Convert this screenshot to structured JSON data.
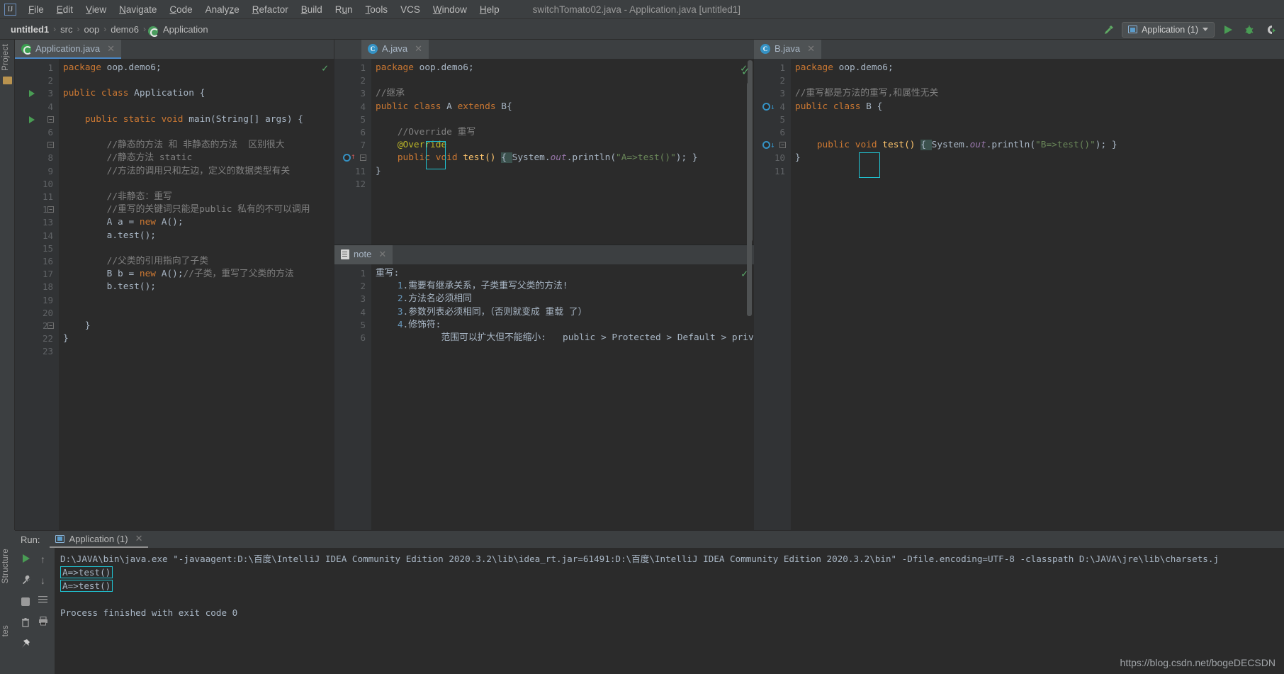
{
  "window": {
    "title": "switchTomato02.java - Application.java [untitled1]",
    "logo_icon": "intellij-idea-logo"
  },
  "menubar": {
    "items": [
      {
        "label": "File",
        "mnemonic": "F"
      },
      {
        "label": "Edit",
        "mnemonic": "E"
      },
      {
        "label": "View",
        "mnemonic": "V"
      },
      {
        "label": "Navigate",
        "mnemonic": "N"
      },
      {
        "label": "Code",
        "mnemonic": "C"
      },
      {
        "label": "Analyze",
        "mnemonic": "z"
      },
      {
        "label": "Refactor",
        "mnemonic": "R"
      },
      {
        "label": "Build",
        "mnemonic": "B"
      },
      {
        "label": "Run",
        "mnemonic": "u"
      },
      {
        "label": "Tools",
        "mnemonic": "T"
      },
      {
        "label": "VCS",
        "mnemonic": ""
      },
      {
        "label": "Window",
        "mnemonic": "W"
      },
      {
        "label": "Help",
        "mnemonic": "H"
      }
    ]
  },
  "breadcrumb": {
    "items": [
      "untitled1",
      "src",
      "oop",
      "demo6",
      "Application"
    ],
    "separator": "›",
    "last_icon": "java-class-icon"
  },
  "toolbar": {
    "build_icon": "hammer-icon",
    "run_config_label": "Application (1)",
    "run_config_icon": "run-configuration-icon",
    "dropdown_icon": "chevron-down-icon",
    "run_icon": "run-triangle-icon",
    "debug_icon": "debug-bug-icon",
    "run_with_coverage_icon": "run-coverage-icon"
  },
  "rails": {
    "left_top": "Project",
    "left_bottom": "Structure",
    "left_bottom2": "tes"
  },
  "editors": {
    "left": {
      "tab": {
        "label": "Application.java",
        "icon": "java-runnable-class-icon",
        "close_icon": "close-icon",
        "active": true
      },
      "inspection_status": "ok",
      "lines": [
        {
          "n": 1,
          "tokens": [
            {
              "t": "package ",
              "c": "kw"
            },
            {
              "t": "oop.demo6;",
              "c": "txt"
            }
          ]
        },
        {
          "n": 2,
          "tokens": []
        },
        {
          "n": 3,
          "tokens": [
            {
              "t": "public class ",
              "c": "kw"
            },
            {
              "t": "Application {",
              "c": "txt"
            }
          ],
          "gutter": "run-triangle"
        },
        {
          "n": 4,
          "tokens": []
        },
        {
          "n": 5,
          "tokens": [
            {
              "t": "    public static void ",
              "c": "kw"
            },
            {
              "t": "main(String[] args) {",
              "c": "txt"
            }
          ],
          "gutter": "run-triangle",
          "fold": true
        },
        {
          "n": 6,
          "tokens": []
        },
        {
          "n": 7,
          "tokens": [
            {
              "t": "        //静态的方法 和 非静态的方法  区别很大",
              "c": "cmt"
            }
          ],
          "fold": true
        },
        {
          "n": 8,
          "tokens": [
            {
              "t": "        //静态方法 static",
              "c": "cmt"
            }
          ]
        },
        {
          "n": 9,
          "tokens": [
            {
              "t": "        //方法的调用只和左边，定义的数据类型有关",
              "c": "cmt"
            }
          ]
        },
        {
          "n": 10,
          "tokens": []
        },
        {
          "n": 11,
          "tokens": [
            {
              "t": "        //非静态：重写",
              "c": "cmt"
            }
          ]
        },
        {
          "n": 12,
          "tokens": [
            {
              "t": "        //重写的关键词只能是public 私有的不可以调用",
              "c": "cmt"
            }
          ],
          "fold": true
        },
        {
          "n": 13,
          "tokens": [
            {
              "t": "        A a = ",
              "c": "txt"
            },
            {
              "t": "new ",
              "c": "kw"
            },
            {
              "t": "A();",
              "c": "txt"
            }
          ]
        },
        {
          "n": 14,
          "tokens": [
            {
              "t": "        a.test();",
              "c": "txt"
            }
          ]
        },
        {
          "n": 15,
          "tokens": []
        },
        {
          "n": 16,
          "tokens": [
            {
              "t": "        //父类的引用指向了子类",
              "c": "cmt"
            }
          ]
        },
        {
          "n": 17,
          "tokens": [
            {
              "t": "        B b = ",
              "c": "txt"
            },
            {
              "t": "new ",
              "c": "kw"
            },
            {
              "t": "A();",
              "c": "txt"
            },
            {
              "t": "//子类，重写了父类的方法",
              "c": "cmt"
            }
          ]
        },
        {
          "n": 18,
          "tokens": [
            {
              "t": "        b.test();",
              "c": "txt"
            }
          ]
        },
        {
          "n": 19,
          "tokens": []
        },
        {
          "n": 20,
          "tokens": []
        },
        {
          "n": 21,
          "tokens": [
            {
              "t": "    }",
              "c": "txt"
            }
          ],
          "fold": true
        },
        {
          "n": 22,
          "tokens": [
            {
              "t": "}",
              "c": "txt"
            }
          ]
        },
        {
          "n": 23,
          "tokens": []
        }
      ]
    },
    "middle": {
      "tab": {
        "label": "A.java",
        "icon": "java-class-icon",
        "close_icon": "close-icon"
      },
      "inspection_status": "ok",
      "lines": [
        {
          "n": 1,
          "tokens": [
            {
              "t": "package ",
              "c": "kw"
            },
            {
              "t": "oop.demo6;",
              "c": "txt"
            }
          ]
        },
        {
          "n": 2,
          "tokens": []
        },
        {
          "n": 3,
          "tokens": [
            {
              "t": "//继承",
              "c": "cmt"
            }
          ]
        },
        {
          "n": 4,
          "tokens": [
            {
              "t": "public class ",
              "c": "kw"
            },
            {
              "t": "A ",
              "c": "txt"
            },
            {
              "t": "extends ",
              "c": "kw"
            },
            {
              "t": "B{",
              "c": "txt"
            }
          ]
        },
        {
          "n": 5,
          "tokens": []
        },
        {
          "n": 6,
          "tokens": [
            {
              "t": "    //Override 重写",
              "c": "cmt"
            }
          ]
        },
        {
          "n": 7,
          "tokens": [
            {
              "t": "    @Override",
              "c": "anno"
            }
          ]
        },
        {
          "n": 8,
          "tokens": [
            {
              "t": "    public void ",
              "c": "kw"
            },
            {
              "t": "test() ",
              "c": "meth"
            },
            {
              "t": "{ ",
              "c": "brace"
            },
            {
              "t": "System.",
              "c": "txt"
            },
            {
              "t": "out",
              "c": "fld"
            },
            {
              "t": ".println(",
              "c": "txt"
            },
            {
              "t": "\"A=>test()\"",
              "c": "str"
            },
            {
              "t": "); }",
              "c": "txt"
            }
          ],
          "gutter": "override-impl",
          "fold": true
        },
        {
          "n": 11,
          "tokens": [
            {
              "t": "}",
              "c": "txt"
            }
          ]
        },
        {
          "n": 12,
          "tokens": []
        }
      ],
      "cursor_box": "text-cursor-highlight"
    },
    "right": {
      "tab": {
        "label": "B.java",
        "icon": "java-class-icon",
        "close_icon": "close-icon"
      },
      "inspection_status": "ok",
      "lines": [
        {
          "n": 1,
          "tokens": [
            {
              "t": "package ",
              "c": "kw"
            },
            {
              "t": "oop.demo6;",
              "c": "txt"
            }
          ]
        },
        {
          "n": 2,
          "tokens": []
        },
        {
          "n": 3,
          "tokens": [
            {
              "t": "//重写都是方法的重写,和属性无关",
              "c": "cmt"
            }
          ]
        },
        {
          "n": 4,
          "tokens": [
            {
              "t": "public class ",
              "c": "kw"
            },
            {
              "t": "B {",
              "c": "txt"
            }
          ],
          "gutter": "overridden-marker"
        },
        {
          "n": 5,
          "tokens": []
        },
        {
          "n": 6,
          "tokens": []
        },
        {
          "n": 7,
          "tokens": [
            {
              "t": "    public void ",
              "c": "kw"
            },
            {
              "t": "test() ",
              "c": "meth"
            },
            {
              "t": "{ ",
              "c": "brace"
            },
            {
              "t": "System.",
              "c": "txt"
            },
            {
              "t": "out",
              "c": "fld"
            },
            {
              "t": ".println(",
              "c": "txt"
            },
            {
              "t": "\"B=>test()\"",
              "c": "str"
            },
            {
              "t": "); }",
              "c": "txt"
            }
          ],
          "gutter": "overridden-marker",
          "fold": true
        },
        {
          "n": 10,
          "tokens": [
            {
              "t": "}",
              "c": "txt"
            }
          ]
        },
        {
          "n": 11,
          "tokens": []
        }
      ],
      "cursor_box": "text-cursor-highlight"
    }
  },
  "note_panel": {
    "tab": {
      "label": "note",
      "icon": "text-file-icon",
      "close_icon": "close-icon"
    },
    "inspection_status": "ok",
    "lines": [
      {
        "n": 1,
        "tokens": [
          {
            "t": "重写:",
            "c": "txt"
          }
        ]
      },
      {
        "n": 2,
        "tokens": [
          {
            "t": "    ",
            "c": "txt"
          },
          {
            "t": "1",
            "c": "num"
          },
          {
            "t": ".需要有继承关系，子类重写父类的方法!",
            "c": "txt"
          }
        ]
      },
      {
        "n": 3,
        "tokens": [
          {
            "t": "    ",
            "c": "txt"
          },
          {
            "t": "2",
            "c": "num"
          },
          {
            "t": ".方法名必须相同",
            "c": "txt"
          }
        ]
      },
      {
        "n": 4,
        "tokens": [
          {
            "t": "    ",
            "c": "txt"
          },
          {
            "t": "3",
            "c": "num"
          },
          {
            "t": ".参数列表必须相同，（否则就变成 重载 了）",
            "c": "txt"
          }
        ]
      },
      {
        "n": 5,
        "tokens": [
          {
            "t": "    ",
            "c": "txt"
          },
          {
            "t": "4",
            "c": "num"
          },
          {
            "t": ".修饰符:",
            "c": "txt"
          }
        ]
      },
      {
        "n": 6,
        "tokens": [
          {
            "t": "            范围可以扩大但不能缩小:   public > Protected > Default > private",
            "c": "txt"
          }
        ]
      }
    ]
  },
  "run_panel": {
    "label": "Run:",
    "tab": {
      "label": "Application (1)",
      "icon": "run-configuration-icon",
      "close_icon": "close-icon"
    },
    "side_tools": [
      {
        "name": "rerun-icon",
        "glyph": "▶"
      },
      {
        "name": "settings-wrench-icon",
        "glyph": "ὒ7"
      },
      {
        "name": "stop-icon",
        "glyph": "■"
      },
      {
        "name": "trash-icon",
        "glyph": "Ὕ1"
      },
      {
        "name": "print-icon",
        "glyph": "⎙"
      },
      {
        "name": "pin-icon",
        "glyph": "ὌC"
      },
      {
        "name": "scroll-up-icon",
        "glyph": "↑"
      },
      {
        "name": "scroll-down-icon",
        "glyph": "↓"
      },
      {
        "name": "soft-wrap-icon",
        "glyph": "↵"
      }
    ],
    "console_lines": [
      "D:\\JAVA\\bin\\java.exe \"-javaagent:D:\\百度\\IntelliJ IDEA Community Edition 2020.3.2\\lib\\idea_rt.jar=61491:D:\\百度\\IntelliJ IDEA Community Edition 2020.3.2\\bin\" -Dfile.encoding=UTF-8 -classpath D:\\JAVA\\jre\\lib\\charsets.j",
      "A=>test()",
      "A=>test()",
      "",
      "Process finished with exit code 0"
    ],
    "highlighted_output": [
      "A=>test()",
      "A=>test()"
    ]
  },
  "watermark": "https://blog.csdn.net/bogeDECSDN",
  "colors": {
    "background": "#3c3f41",
    "editor_bg": "#2b2b2b",
    "gutter_bg": "#313335",
    "accent_blue": "#4a88c7",
    "keyword_orange": "#cc7832",
    "comment_gray": "#808080",
    "string_green": "#6a8759",
    "highlight_cyan": "#20c5d4",
    "ok_green": "#59a869"
  }
}
